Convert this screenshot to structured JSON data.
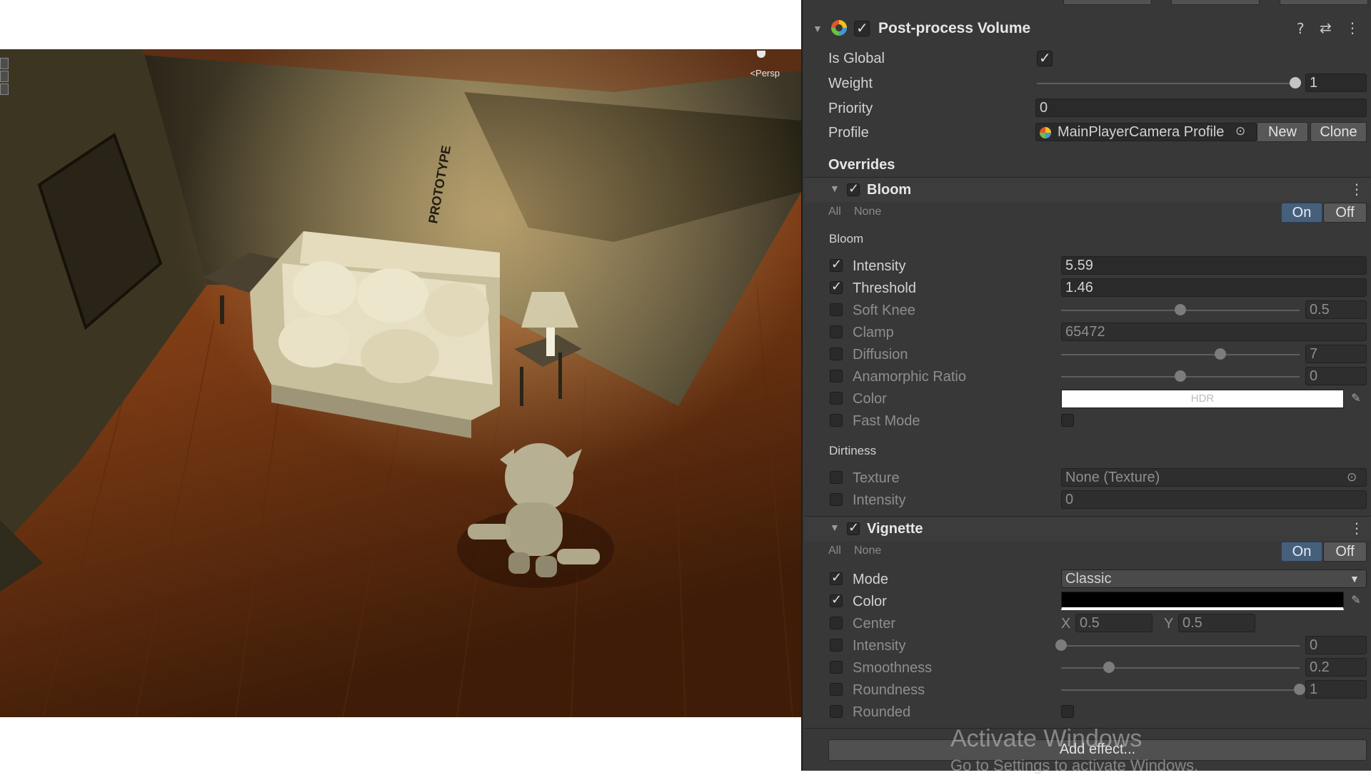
{
  "scene": {
    "camera_label": "<Persp"
  },
  "volume": {
    "title": "Post-process Volume",
    "is_global_label": "Is Global",
    "weight_label": "Weight",
    "weight_value": "1",
    "weight_fraction": 1.0,
    "priority_label": "Priority",
    "priority_value": "0",
    "profile_label": "Profile",
    "profile_value": "MainPlayerCamera Profile",
    "new_label": "New",
    "clone_label": "Clone",
    "overrides_label": "Overrides"
  },
  "bloom": {
    "title": "Bloom",
    "all_label": "All",
    "none_label": "None",
    "on_label": "On",
    "off_label": "Off",
    "group_bloom": "Bloom",
    "intensity_label": "Intensity",
    "intensity_value": "5.59",
    "threshold_label": "Threshold",
    "threshold_value": "1.46",
    "soft_knee_label": "Soft Knee",
    "soft_knee_value": "0.5",
    "soft_knee_fraction": 0.5,
    "clamp_label": "Clamp",
    "clamp_value": "65472",
    "diffusion_label": "Diffusion",
    "diffusion_value": "7",
    "diffusion_fraction": 0.667,
    "anamorphic_label": "Anamorphic Ratio",
    "anamorphic_value": "0",
    "anamorphic_fraction": 0.5,
    "color_label": "Color",
    "color_hdr_text": "HDR",
    "fast_mode_label": "Fast Mode",
    "group_dirtiness": "Dirtiness",
    "texture_label": "Texture",
    "texture_value": "None (Texture)",
    "dirt_intensity_label": "Intensity",
    "dirt_intensity_value": "0"
  },
  "vignette": {
    "title": "Vignette",
    "all_label": "All",
    "none_label": "None",
    "on_label": "On",
    "off_label": "Off",
    "mode_label": "Mode",
    "mode_value": "Classic",
    "color_label": "Color",
    "center_label": "Center",
    "center_x_label": "X",
    "center_x_value": "0.5",
    "center_y_label": "Y",
    "center_y_value": "0.5",
    "intensity_label": "Intensity",
    "intensity_value": "0",
    "intensity_fraction": 0,
    "smoothness_label": "Smoothness",
    "smoothness_value": "0.2",
    "smoothness_fraction": 0.2,
    "roundness_label": "Roundness",
    "roundness_value": "1",
    "roundness_fraction": 1.0,
    "rounded_label": "Rounded"
  },
  "add_effect_label": "Add effect...",
  "watermark": {
    "line1": "Activate Windows",
    "line2": "Go to Settings to activate Windows."
  },
  "colors": {
    "inspector_bg": "#383838",
    "active_toggle": "#46607c",
    "floor": "#8a4418"
  }
}
